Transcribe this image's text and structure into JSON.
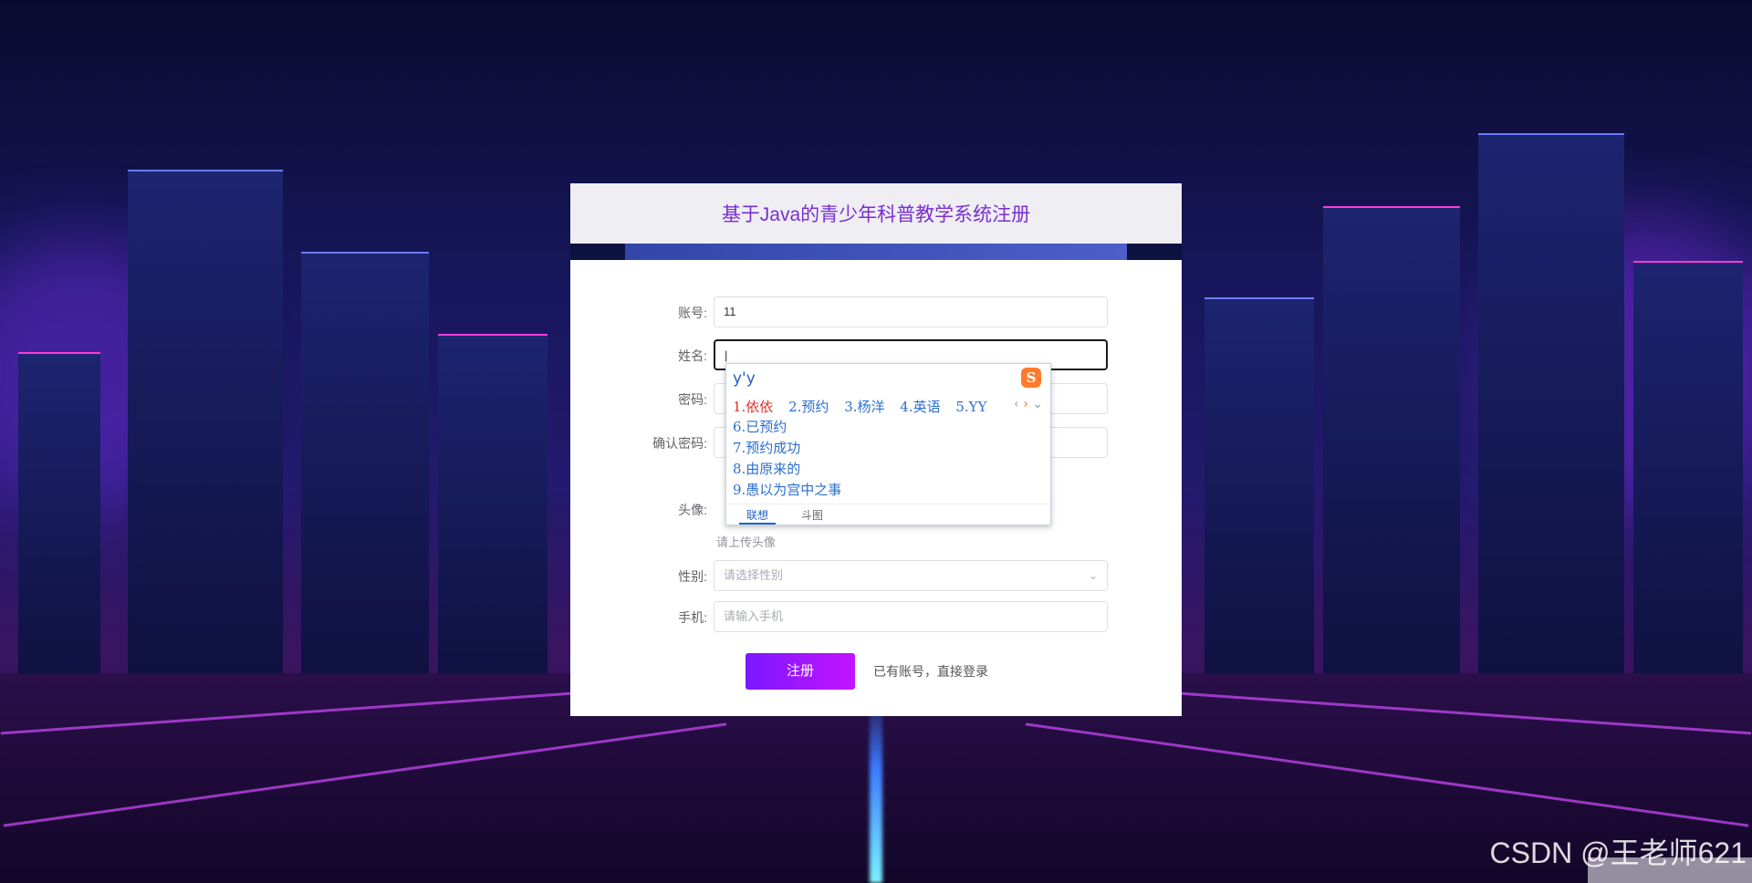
{
  "page": {
    "title": "基于Java的青少年科普教学系统注册"
  },
  "form": {
    "account": {
      "label": "账号:",
      "value": "11"
    },
    "name": {
      "label": "姓名:",
      "value": "|"
    },
    "password": {
      "label": "密码:"
    },
    "confirm_password": {
      "label": "确认密码:"
    },
    "avatar": {
      "label": "头像:",
      "hint": "请上传头像"
    },
    "gender": {
      "label": "性别:",
      "placeholder": "请选择性别"
    },
    "phone": {
      "label": "手机:",
      "placeholder": "请输入手机"
    },
    "submit_label": "注册",
    "login_link": "已有账号，直接登录"
  },
  "ime": {
    "composition": "y'y",
    "logo": "S",
    "row_candidates": [
      "1.依依",
      "2.预约",
      "3.杨洋",
      "4.英语",
      "5.YY"
    ],
    "list_candidates": [
      "6.已预约",
      "7.预约成功",
      "8.由原来的",
      "9.愚以为宫中之事"
    ],
    "tabs": [
      "联想",
      "斗图"
    ],
    "prev_icon": "chevron-left-icon",
    "next_icon": "chevron-right-icon",
    "expand_icon": "chevron-down-icon"
  },
  "watermark": "CSDN @王老师621",
  "colors": {
    "title": "#7a2fd0",
    "button_start": "#7a18ff",
    "button_end": "#c413ff",
    "ime_blue": "#2b6fcf",
    "ime_first": "#e03030"
  }
}
